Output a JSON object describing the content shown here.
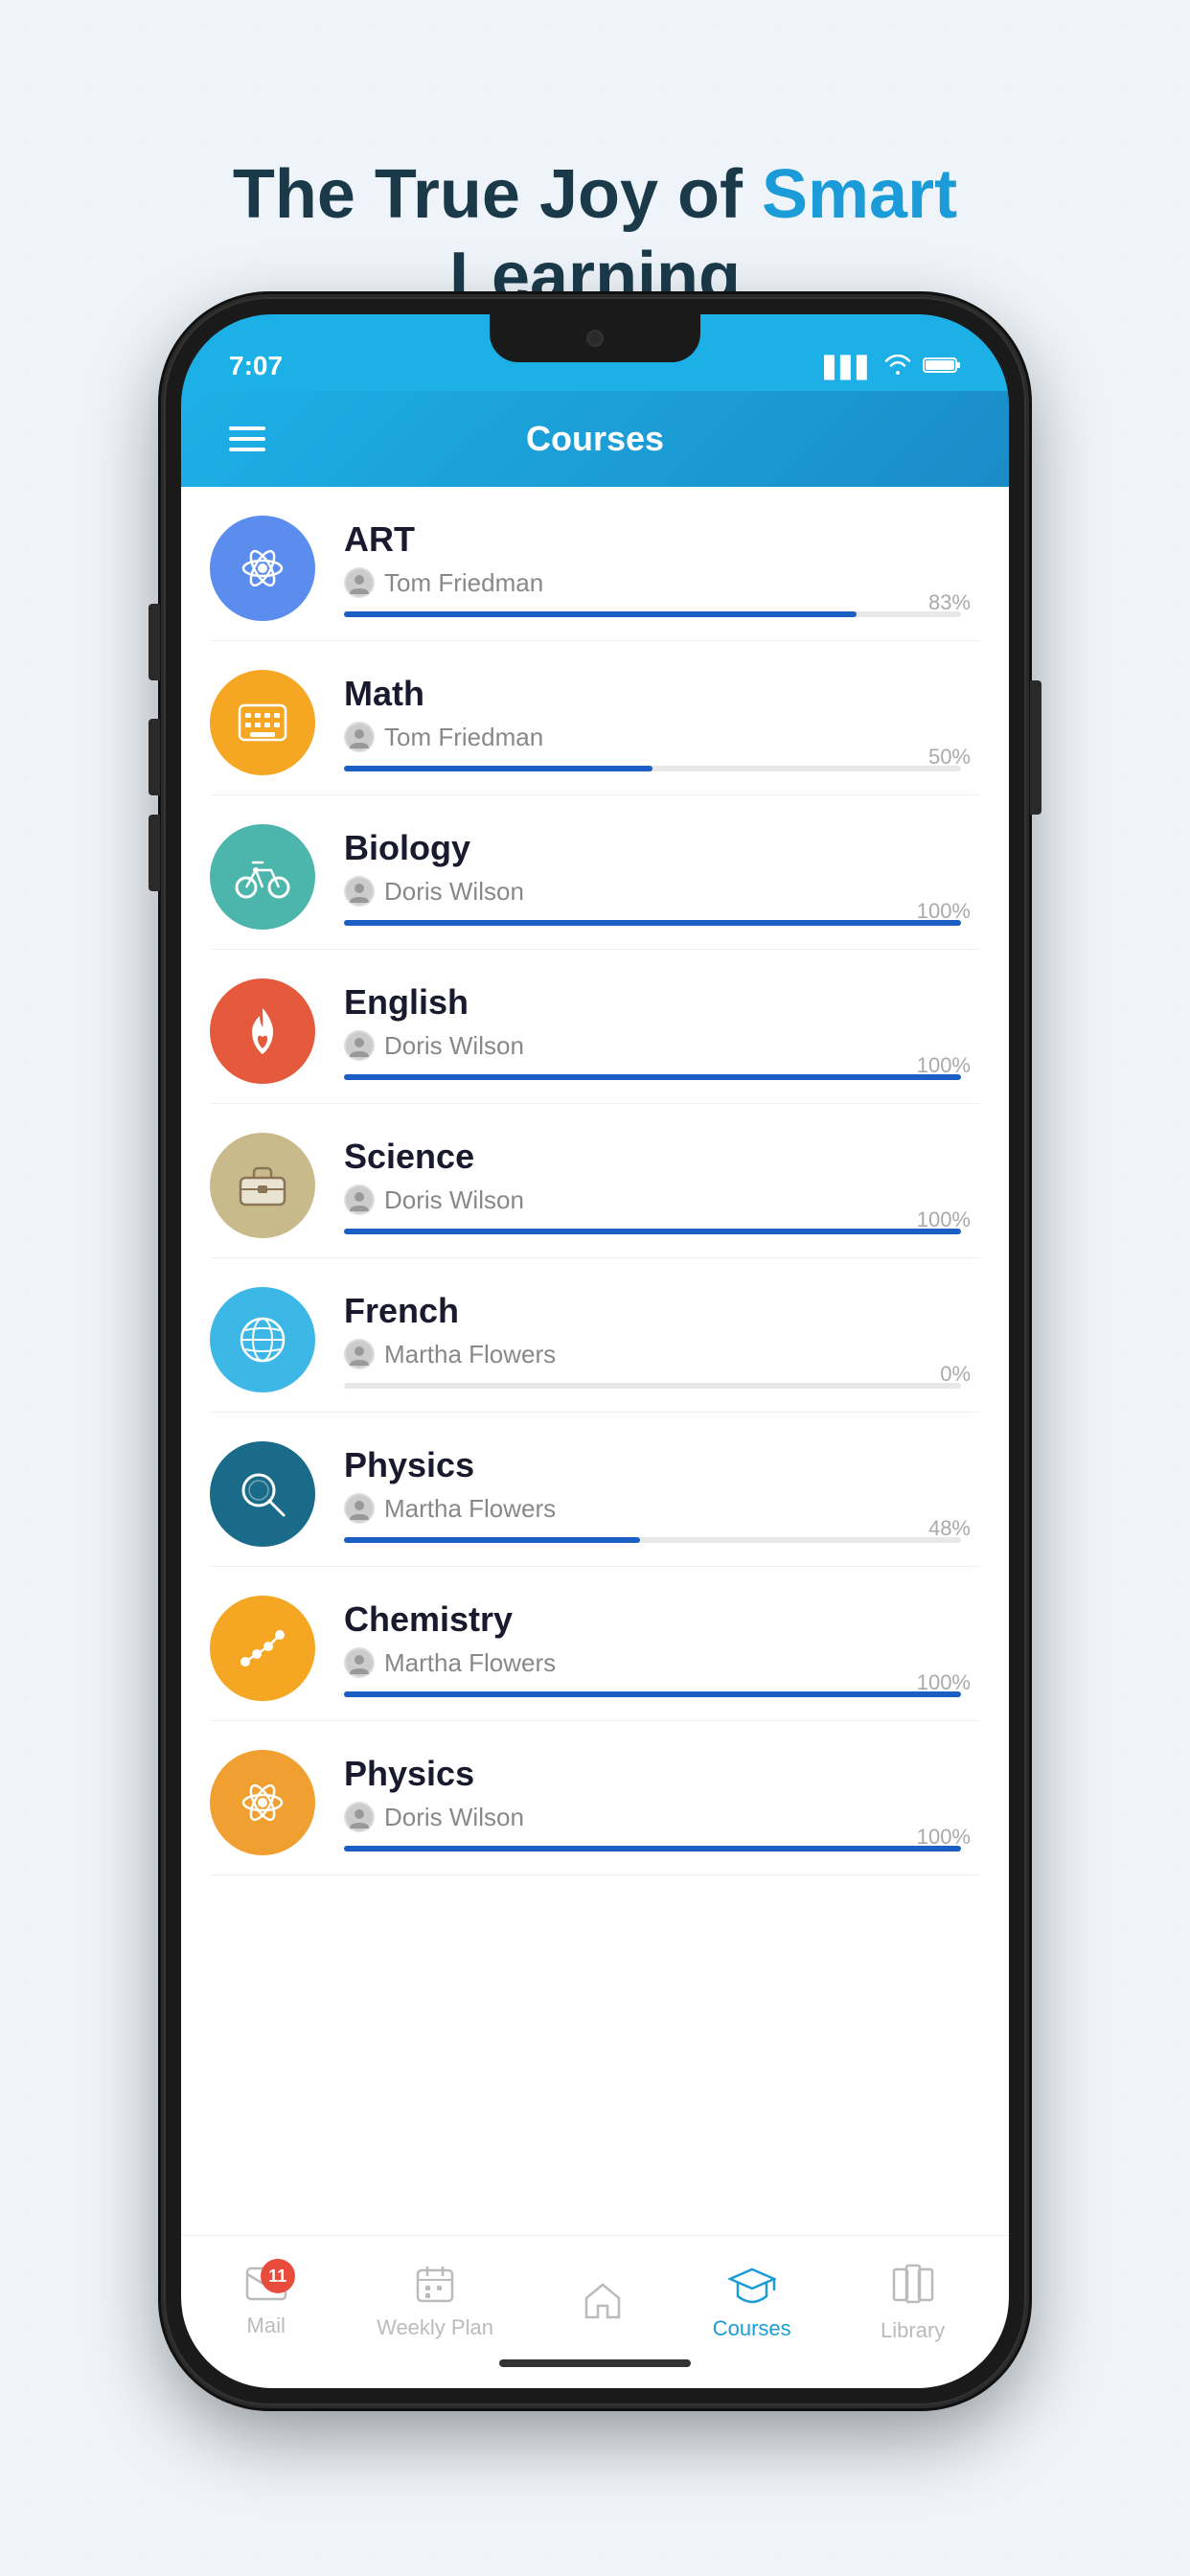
{
  "hero": {
    "line1": "The True Joy of",
    "highlight": "Smart",
    "line2": "Learning"
  },
  "statusBar": {
    "time": "7:07",
    "signal": "▋▋▋",
    "wifi": "WiFi",
    "battery": "🔋"
  },
  "header": {
    "title": "Courses"
  },
  "courses": [
    {
      "name": "ART",
      "teacher": "Tom Friedman",
      "progress": 83,
      "iconColor": "#dce8ff",
      "iconEmoji": "⚛",
      "iconBg": "#5b8dee"
    },
    {
      "name": "Math",
      "teacher": "Tom Friedman",
      "progress": 50,
      "iconColor": "#f5a623",
      "iconEmoji": "⌨",
      "iconBg": "#f5a623"
    },
    {
      "name": "Biology",
      "teacher": "Doris Wilson",
      "progress": 100,
      "iconColor": "#4db6ac",
      "iconEmoji": "🚴",
      "iconBg": "#4db6ac"
    },
    {
      "name": "English",
      "teacher": "Doris Wilson",
      "progress": 100,
      "iconColor": "#e55a3c",
      "iconEmoji": "🔥",
      "iconBg": "#e55a3c"
    },
    {
      "name": "Science",
      "teacher": "Doris Wilson",
      "progress": 100,
      "iconColor": "#c8c5a5",
      "iconEmoji": "💼",
      "iconBg": "#c8c5a5"
    },
    {
      "name": "French",
      "teacher": "Martha Flowers",
      "progress": 0,
      "iconColor": "#3db8e6",
      "iconEmoji": "🌐",
      "iconBg": "#3db8e6"
    },
    {
      "name": "Physics",
      "teacher": "Martha Flowers",
      "progress": 48,
      "iconColor": "#1a6b8a",
      "iconEmoji": "🔍",
      "iconBg": "#1a6b8a"
    },
    {
      "name": "Chemistry",
      "teacher": "Martha Flowers",
      "progress": 100,
      "iconColor": "#f5a623",
      "iconEmoji": "📈",
      "iconBg": "#f5a623"
    },
    {
      "name": "Physics",
      "teacher": "Doris Wilson",
      "progress": 100,
      "iconColor": "#f0a030",
      "iconEmoji": "⚛",
      "iconBg": "#f0a030"
    }
  ],
  "bottomNav": [
    {
      "label": "Mail",
      "icon": "✉",
      "active": false,
      "badge": 11
    },
    {
      "label": "Weekly Plan",
      "icon": "📅",
      "active": false,
      "badge": null
    },
    {
      "label": "",
      "icon": "⬤",
      "active": false,
      "badge": null
    },
    {
      "label": "Courses",
      "icon": "🎓",
      "active": true,
      "badge": null
    },
    {
      "label": "Library",
      "icon": "📚",
      "active": false,
      "badge": null
    }
  ]
}
